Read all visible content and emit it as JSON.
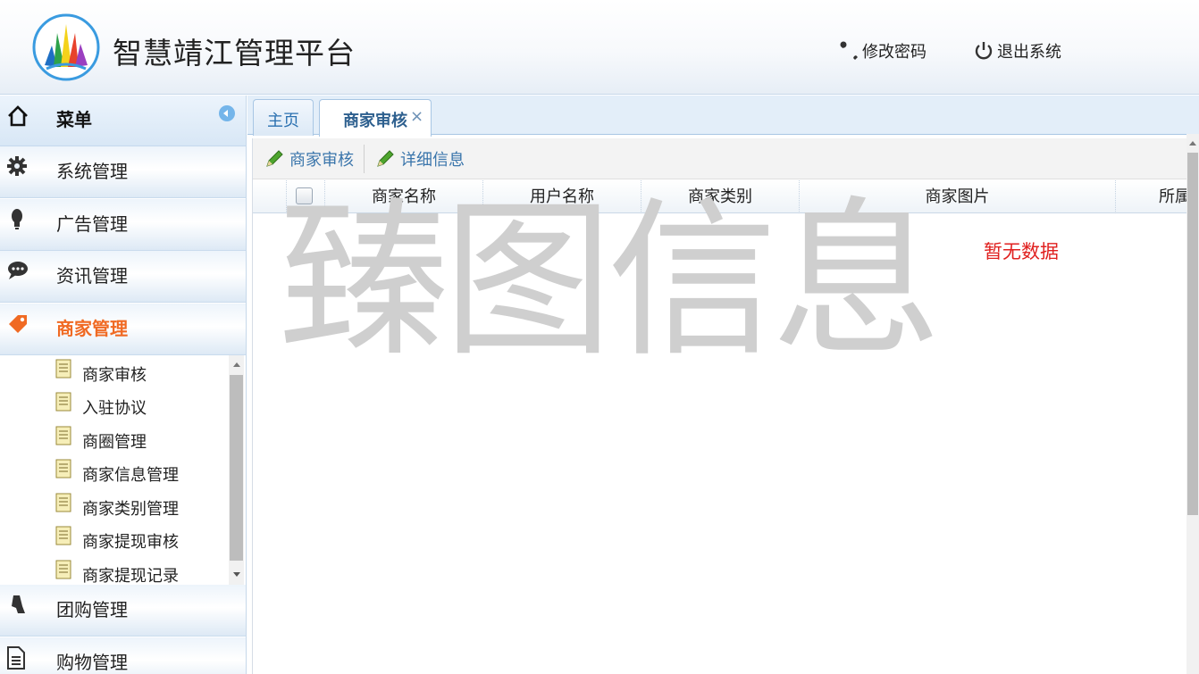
{
  "header": {
    "title": "智慧靖江管理平台",
    "change_password": "修改密码",
    "logout": "退出系统"
  },
  "sidebar": {
    "menu_title": "菜单",
    "groups": [
      {
        "label": "系统管理",
        "icon": "gear-icon"
      },
      {
        "label": "广告管理",
        "icon": "lightbulb-icon"
      },
      {
        "label": "资讯管理",
        "icon": "chat-bubble-icon"
      },
      {
        "label": "商家管理",
        "icon": "tag-icon",
        "active": true
      },
      {
        "label": "团购管理",
        "icon": "hand-icon"
      },
      {
        "label": "购物管理",
        "icon": "document-icon"
      }
    ],
    "sub_items": [
      {
        "label": "商家审核"
      },
      {
        "label": "入驻协议"
      },
      {
        "label": "商圈管理"
      },
      {
        "label": "商家信息管理"
      },
      {
        "label": "商家类别管理"
      },
      {
        "label": "商家提现审核"
      },
      {
        "label": "商家提现记录"
      }
    ]
  },
  "tabs": [
    {
      "label": "主页"
    },
    {
      "label": "商家审核",
      "active": true,
      "close": "×"
    }
  ],
  "toolbar": {
    "audit_label": "商家审核",
    "detail_label": "详细信息"
  },
  "grid": {
    "columns": [
      "商家名称",
      "用户名称",
      "商家类别",
      "商家图片",
      "所属"
    ],
    "empty_text": "暂无数据"
  },
  "watermark": "臻图信息",
  "colors": {
    "active_menu": "#f06a23",
    "link_blue": "#3a75ab",
    "empty_red": "#e0201f"
  }
}
